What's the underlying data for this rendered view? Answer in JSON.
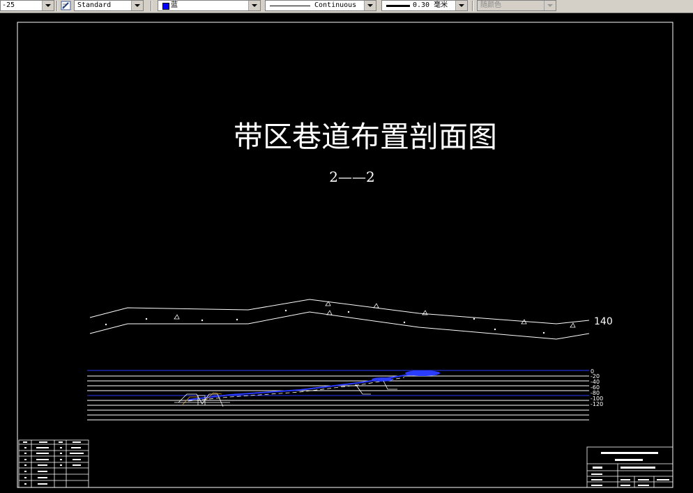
{
  "toolbar": {
    "dimstyle_value": "-25",
    "textstyle_value": "Standard",
    "color_value": "蓝",
    "color_hex": "#0000ff",
    "linetype_value": "Continuous",
    "lineweight_value": "0.30 毫米",
    "plotstyle_value": "随颜色"
  },
  "drawing": {
    "title": "带区巷道布置剖面图",
    "section_label": "2——2",
    "elevation_label": "140",
    "depth_labels": [
      "0",
      "-20",
      "-40",
      "-60",
      "-80",
      "-100",
      "-120"
    ]
  }
}
